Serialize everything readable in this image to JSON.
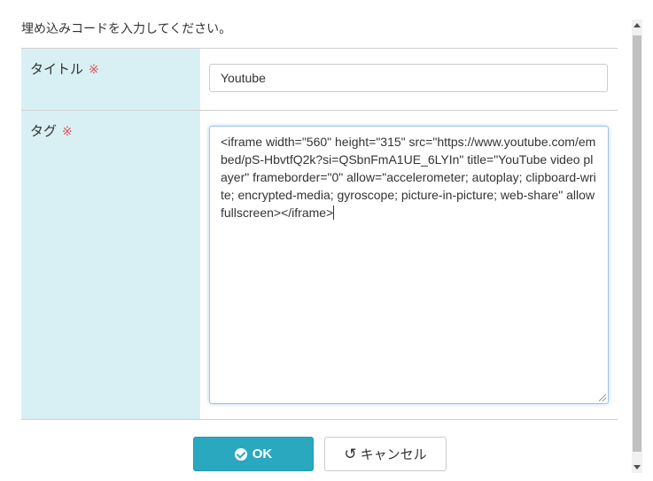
{
  "instruction": "埋め込みコードを入力してください。",
  "required_mark": "※",
  "title_row": {
    "label": "タイトル",
    "value": "Youtube"
  },
  "tag_row": {
    "label": "タグ",
    "value": "<iframe width=\"560\" height=\"315\" src=\"https://www.youtube.com/embed/pS-HbvtfQ2k?si=QSbnFmA1UE_6LYIn\" title=\"YouTube video player\" frameborder=\"0\" allow=\"accelerometer; autoplay; clipboard-write; encrypted-media; gyroscope; picture-in-picture; web-share\" allowfullscreen></iframe>"
  },
  "buttons": {
    "ok_label": "OK",
    "cancel_label": "キャンセル"
  },
  "icons": {
    "ok": "check-circle-icon",
    "cancel": "undo-icon"
  },
  "colors": {
    "label_background": "#d8f0f3",
    "ok_button": "#2aa8c0",
    "required": "#e05555"
  }
}
